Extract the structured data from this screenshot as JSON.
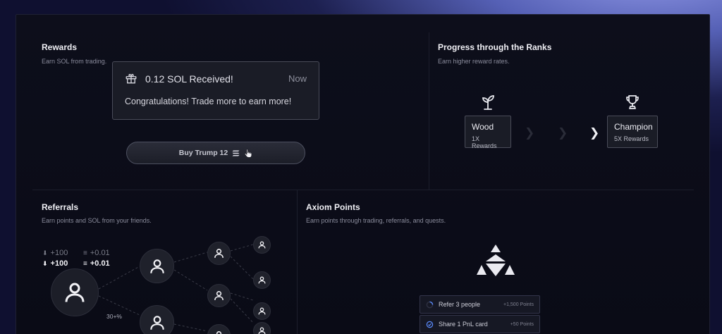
{
  "rewards": {
    "title": "Rewards",
    "subtitle": "Earn SOL from trading.",
    "card": {
      "amount": "0.12 SOL Received!",
      "time": "Now",
      "message": "Congratulations! Trade more to earn more!"
    },
    "buy_button": "Buy Trump 12"
  },
  "ranks": {
    "title": "Progress through the Ranks",
    "subtitle": "Earn higher reward rates.",
    "from": {
      "name": "Wood",
      "rate": "1X Rewards"
    },
    "to": {
      "name": "Champion",
      "rate": "5X Rewards"
    }
  },
  "referrals": {
    "title": "Referrals",
    "subtitle": "Earn points and SOL from your friends.",
    "stats": [
      {
        "points": "+100",
        "sol": "+0.01",
        "dim": true
      },
      {
        "points": "+100",
        "sol": "+0.01",
        "dim": false
      }
    ],
    "tier_tag": "30+%"
  },
  "axiom": {
    "title": "Axiom Points",
    "subtitle": "Earn points through trading, referrals, and quests.",
    "quests": [
      {
        "label": "Refer 3 people",
        "points": "+1,500 Points"
      },
      {
        "label": "Share 1 PnL card",
        "points": "+50 Points"
      }
    ]
  },
  "colors": {
    "accent": "#5b8cff",
    "background": "#0b0c17"
  }
}
